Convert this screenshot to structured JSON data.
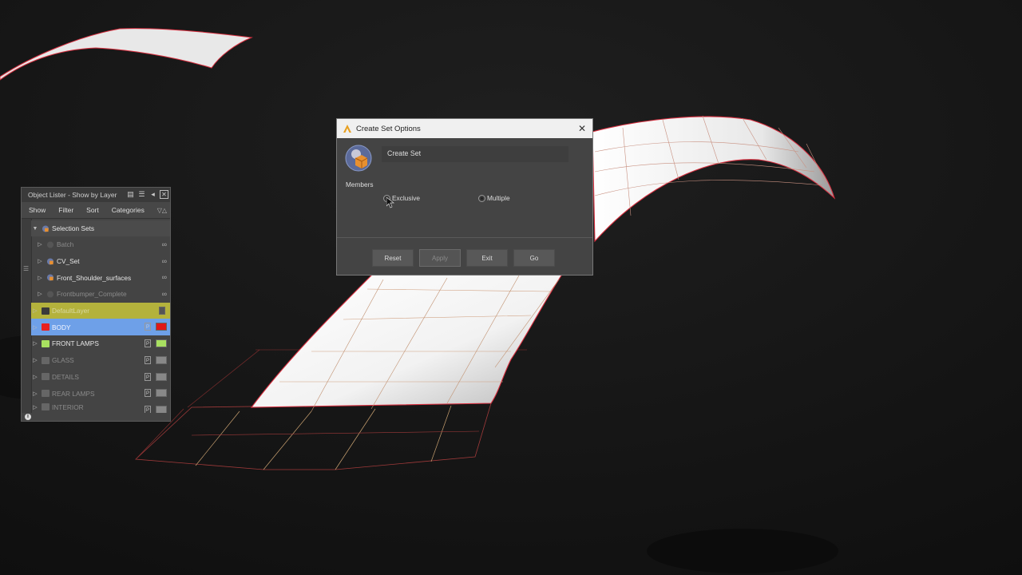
{
  "colors": {
    "background": "#141414",
    "surface_red": "#e03040",
    "layer_yellow": "#b4b23c",
    "layer_blue": "#6ea0e8",
    "body_red": "#e01818",
    "lamps_green": "#a8e060"
  },
  "object_lister": {
    "title": "Object Lister - Show by Layer",
    "menu": [
      "Show",
      "Filter",
      "Sort",
      "Categories"
    ],
    "selection_sets_label": "Selection Sets",
    "selection_sets": [
      {
        "label": "Batch",
        "dim": true
      },
      {
        "label": "CV_Set",
        "dim": false
      },
      {
        "label": "Front_Shoulder_surfaces",
        "dim": false
      },
      {
        "label": "Frontbumper_Complete",
        "dim": true
      }
    ],
    "layers": [
      {
        "label": "DefaultLayer",
        "state": "yellow",
        "color": "#555555"
      },
      {
        "label": "BODY",
        "state": "blue",
        "color": "#e01818"
      },
      {
        "label": "FRONT LAMPS",
        "state": "normal",
        "color": "#a8e060"
      },
      {
        "label": "GLASS",
        "state": "dim",
        "color": "#888888"
      },
      {
        "label": "DETAILS",
        "state": "dim",
        "color": "#888888"
      },
      {
        "label": "REAR LAMPS",
        "state": "dim",
        "color": "#888888"
      },
      {
        "label": "INTERIOR",
        "state": "dim",
        "color": "#888888"
      }
    ]
  },
  "dialog": {
    "title": "Create Set Options",
    "header_label": "Create Set",
    "members_label": "Members",
    "radio_exclusive": "Exclusive",
    "radio_multiple": "Multiple",
    "buttons": {
      "reset": "Reset",
      "apply": "Apply",
      "exit": "Exit",
      "go": "Go"
    }
  }
}
